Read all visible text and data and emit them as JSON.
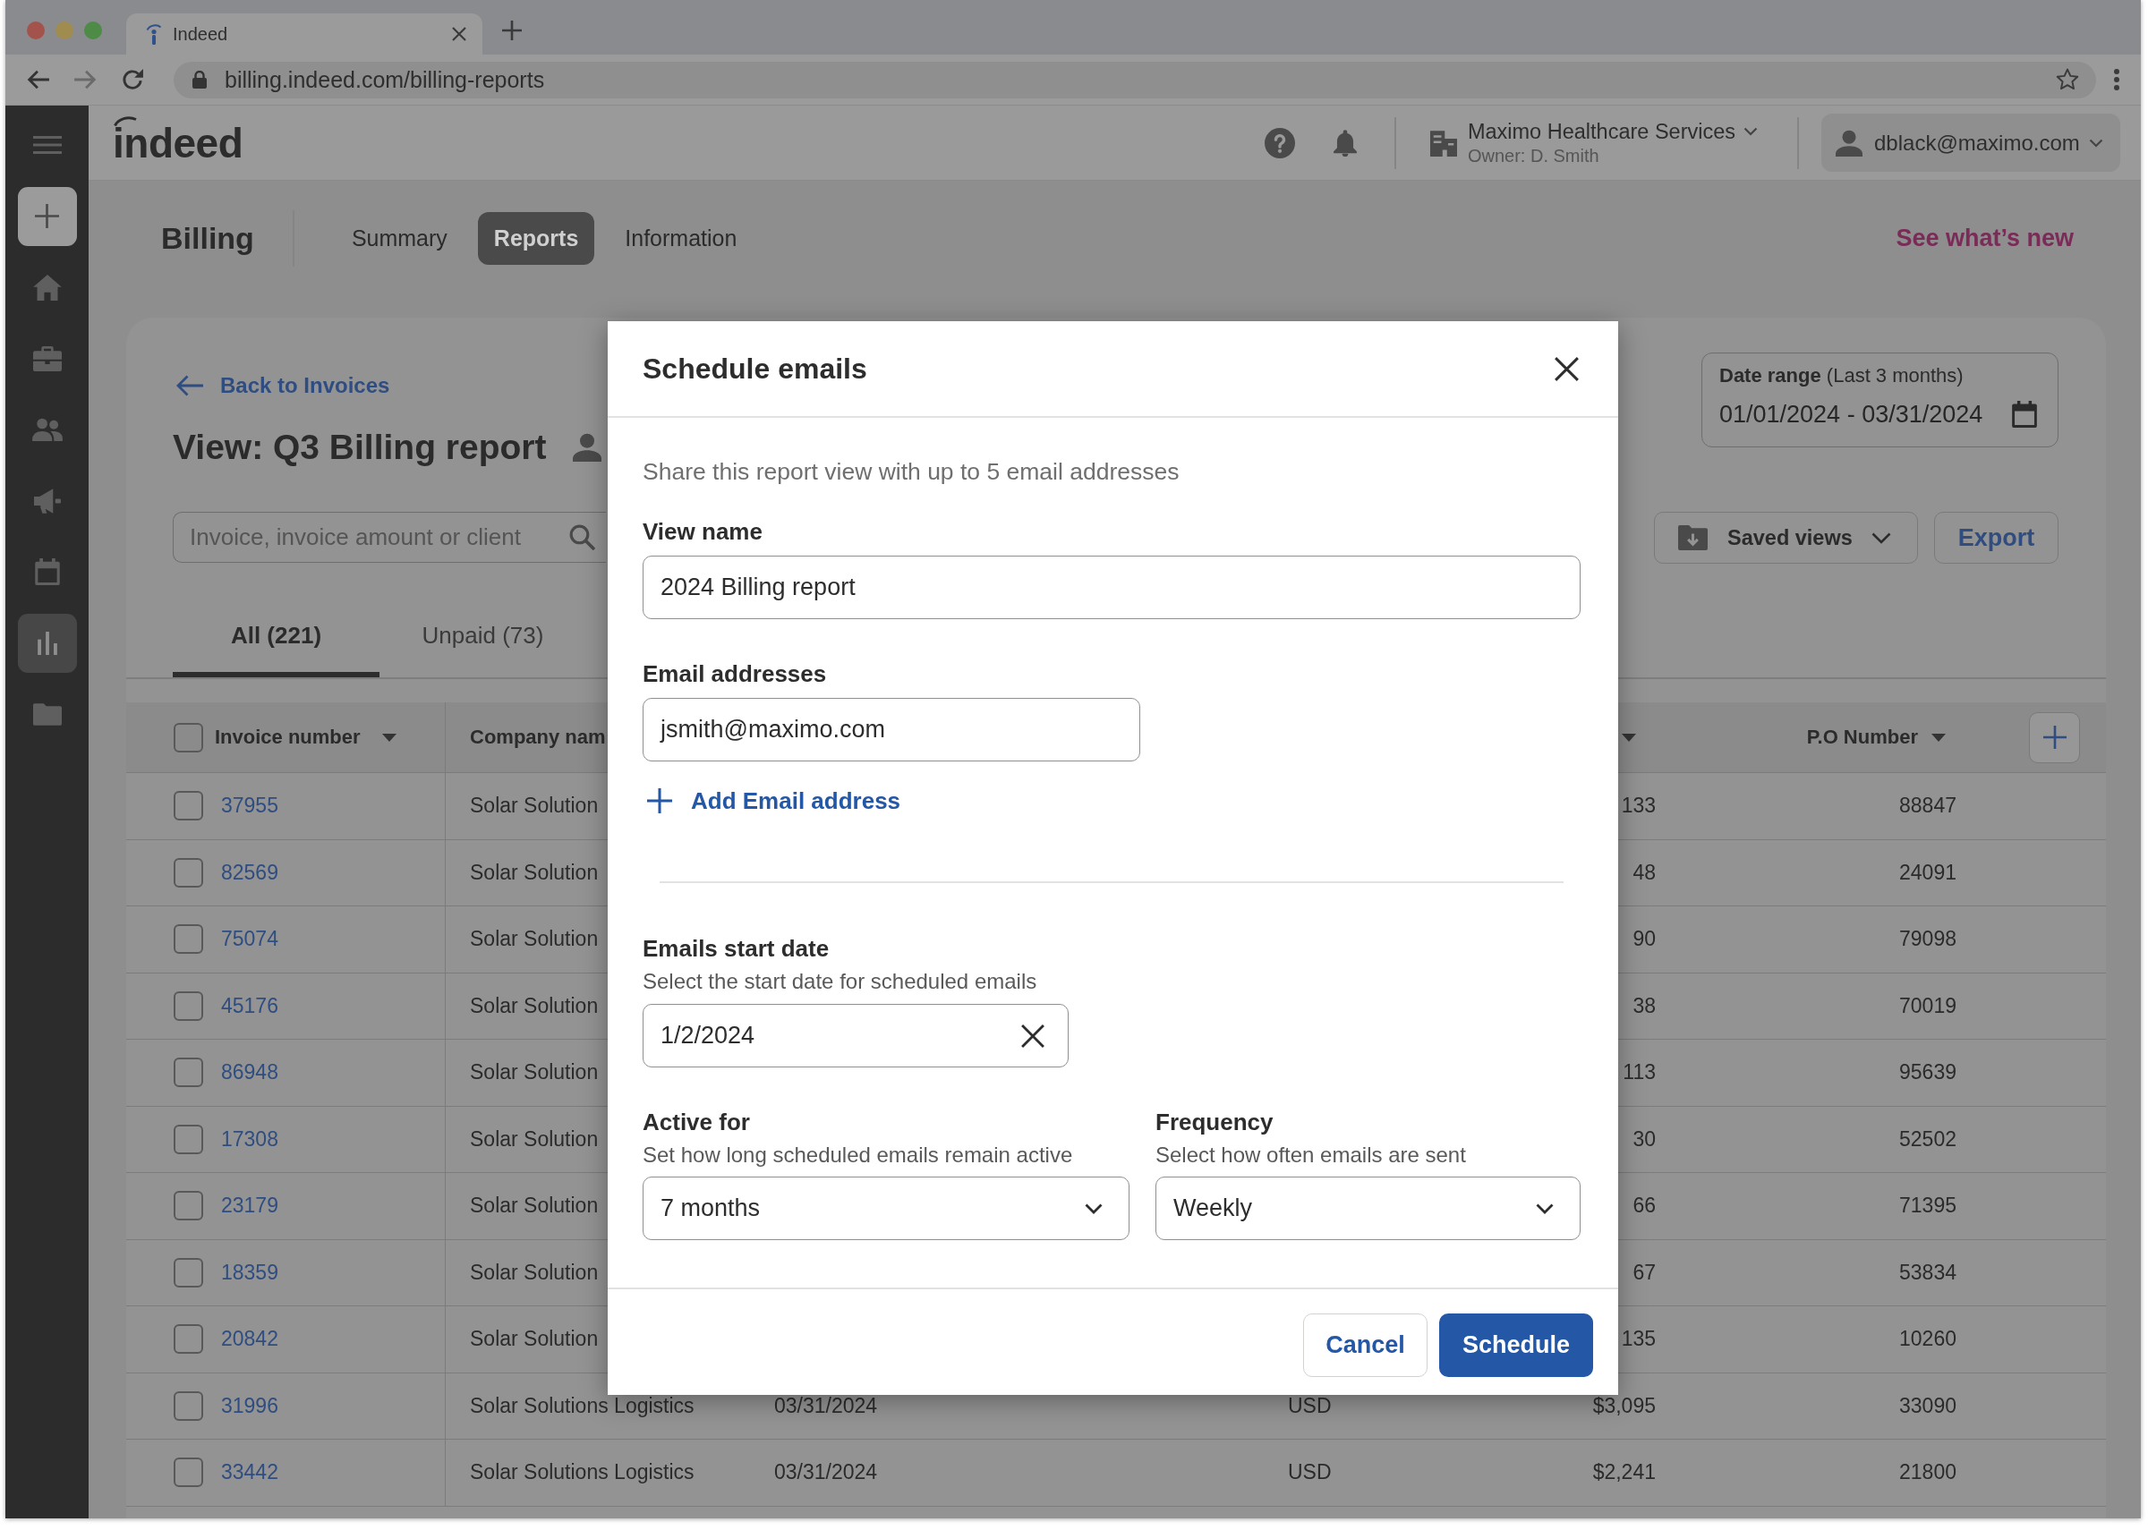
{
  "browser": {
    "tab_title": "Indeed",
    "url": "billing.indeed.com/billing-reports"
  },
  "header": {
    "logo": "indeed",
    "organization": "Maximo Healthcare Services",
    "owner": "Owner: D. Smith",
    "account": "dblack@maximo.com"
  },
  "sidebar": {
    "items": [
      {
        "selected": false
      },
      {
        "selected": false
      },
      {
        "selected": false
      },
      {
        "selected": false
      },
      {
        "selected": false
      },
      {
        "selected": true
      },
      {
        "selected": false
      }
    ]
  },
  "billing": {
    "title": "Billing",
    "tabs": [
      {
        "label": "Summary",
        "selected": false
      },
      {
        "label": "Reports",
        "selected": true
      },
      {
        "label": "Information",
        "selected": false
      }
    ],
    "whats_new": "See what’s new"
  },
  "report": {
    "back_link": "Back to Invoices",
    "title": "View: Q3 Billing report",
    "search": {
      "placeholder": "Invoice, invoice amount or client"
    },
    "tabs": [
      {
        "label": "All (221)",
        "selected": true
      },
      {
        "label": "Unpaid (73)",
        "selected": false
      }
    ],
    "date_range": {
      "label": "**Date range** (Last 3 months)",
      "value": "01/01/2024 - 03/31/2024"
    },
    "saved_views": "Saved views",
    "export": "Export"
  },
  "table": {
    "select_all_checked": false,
    "columns": {
      "invoice_number": {
        "label": "Invoice number",
        "sortable": true
      },
      "column_2": {
        "label": "Company nam"
      },
      "column_5": {
        "sortable": true
      },
      "po_number": {
        "label": "P.O Number",
        "sortable": true
      }
    },
    "rows": [
      {
        "checked": false,
        "invoice_number": "37955",
        "column_2": "Solar Solution",
        "column_5": "133",
        "po_number": "88847"
      },
      {
        "checked": false,
        "invoice_number": "82569",
        "column_2": "Solar Solution",
        "column_5": "48",
        "po_number": "24091"
      },
      {
        "checked": false,
        "invoice_number": "75074",
        "column_2": "Solar Solution",
        "column_5": "90",
        "po_number": "79098"
      },
      {
        "checked": false,
        "invoice_number": "45176",
        "column_2": "Solar Solution",
        "column_5": "38",
        "po_number": "70019"
      },
      {
        "checked": false,
        "invoice_number": "86948",
        "column_2": "Solar Solution",
        "column_5": "113",
        "po_number": "95639"
      },
      {
        "checked": false,
        "invoice_number": "17308",
        "column_2": "Solar Solution",
        "column_5": "30",
        "po_number": "52502"
      },
      {
        "checked": false,
        "invoice_number": "23179",
        "column_2": "Solar Solution",
        "column_5": "66",
        "po_number": "71395"
      },
      {
        "checked": false,
        "invoice_number": "18359",
        "column_2": "Solar Solution",
        "column_5": "67",
        "po_number": "53834"
      },
      {
        "checked": false,
        "invoice_number": "20842",
        "column_2": "Solar Solution",
        "column_5": "135",
        "po_number": "10260"
      },
      {
        "checked": false,
        "invoice_number": "31996",
        "column_2": "Solar Solutions Logistics",
        "column_3": "03/31/2024",
        "column_4": "USD",
        "column_5": "$3,095",
        "po_number": "33090"
      },
      {
        "checked": false,
        "invoice_number": "33442",
        "column_2": "Solar Solutions Logistics",
        "column_3": "03/31/2024",
        "column_4": "USD",
        "column_5": "$2,241",
        "po_number": "21800"
      }
    ]
  },
  "modal": {
    "title": "Schedule emails",
    "intro": "Share this report view with up to 5 email addresses",
    "view_name": {
      "label": "View name",
      "value": "2024 Billing report"
    },
    "email_addresses": {
      "label": "Email addresses",
      "values": [
        "jsmith@maximo.com"
      ],
      "add_link": "Add Email address"
    },
    "start_date": {
      "label": "Emails start date",
      "hint": "Select the start date for scheduled emails",
      "value": "1/2/2024"
    },
    "active_for": {
      "label": "Active for",
      "hint": "Set how long scheduled emails remain active",
      "value": "7 months"
    },
    "frequency": {
      "label": "Frequency",
      "hint": "Select how often emails are sent",
      "value": "Weekly"
    },
    "buttons": [
      {
        "label": "Cancel",
        "kind": "secondary"
      },
      {
        "label": "Schedule",
        "kind": "primary"
      }
    ]
  }
}
